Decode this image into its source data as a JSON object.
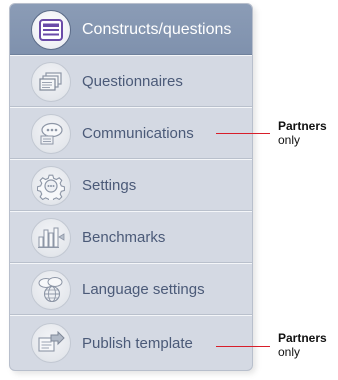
{
  "menu": {
    "items": [
      {
        "label": "Constructs/questions",
        "icon": "form-icon",
        "active": true
      },
      {
        "label": "Questionnaires",
        "icon": "stacked-pages-icon"
      },
      {
        "label": "Communications",
        "icon": "chat-bubble-icon"
      },
      {
        "label": "Settings",
        "icon": "gear-icon"
      },
      {
        "label": "Benchmarks",
        "icon": "bar-chart-icon"
      },
      {
        "label": "Language settings",
        "icon": "globe-chat-icon"
      },
      {
        "label": "Publish template",
        "icon": "publish-arrow-icon"
      }
    ]
  },
  "annotations": [
    {
      "title": "Partners",
      "subtitle": "only"
    },
    {
      "title": "Partners",
      "subtitle": "only"
    }
  ],
  "colors": {
    "active_bg": "#8092ae",
    "item_bg": "#d4d9e3",
    "label": "#4b5a78",
    "accent_icon": "#6a4aa8",
    "annotation_line": "#d81e2a"
  }
}
